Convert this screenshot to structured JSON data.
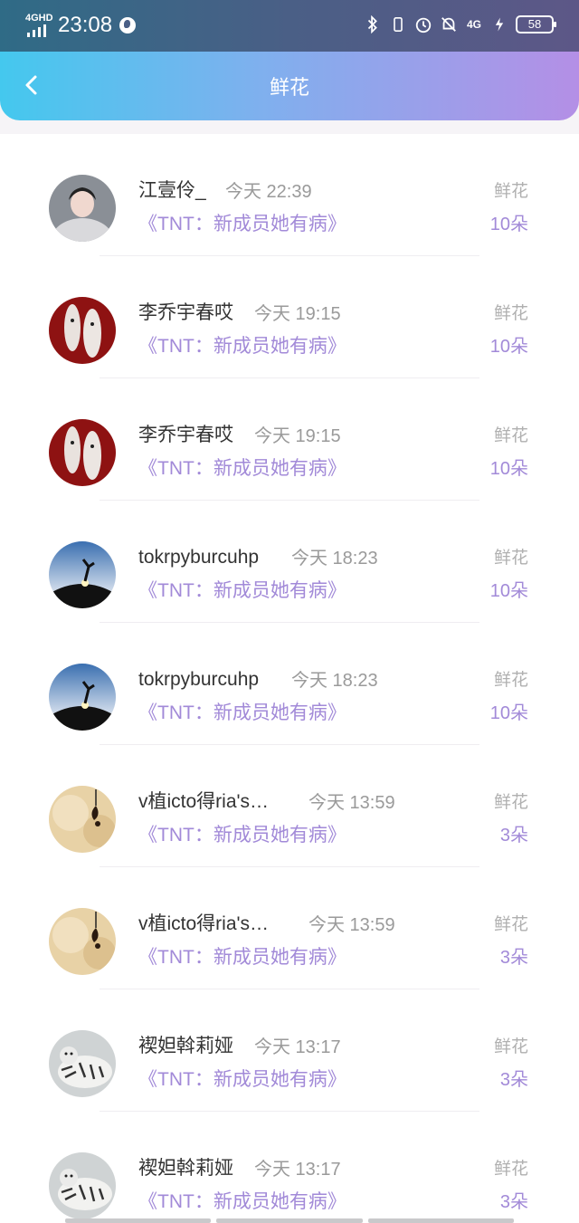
{
  "status_bar": {
    "network_label": "4GHD",
    "time": "23:08",
    "network_type": "4G",
    "battery": "58"
  },
  "nav": {
    "title": "鲜花"
  },
  "rows": [
    {
      "name": "江壹伶_",
      "time": "今天 22:39",
      "book": "《TNT：新成员她有病》",
      "gift": "鲜花",
      "count": "10朵",
      "avatar": "hoodie-person"
    },
    {
      "name": "李乔宇春哎",
      "time": "今天 19:15",
      "book": "《TNT：新成员她有病》",
      "gift": "鲜花",
      "count": "10朵",
      "avatar": "red-figures"
    },
    {
      "name": "李乔宇春哎",
      "time": "今天 19:15",
      "book": "《TNT：新成员她有病》",
      "gift": "鲜花",
      "count": "10朵",
      "avatar": "red-figures"
    },
    {
      "name": "tokrpyburcuhp",
      "time": "今天 18:23",
      "book": "《TNT：新成员她有病》",
      "gift": "鲜花",
      "count": "10朵",
      "avatar": "sunset-dancer"
    },
    {
      "name": "tokrpyburcuhp",
      "time": "今天 18:23",
      "book": "《TNT：新成员她有病》",
      "gift": "鲜花",
      "count": "10朵",
      "avatar": "sunset-dancer"
    },
    {
      "name": "v植icto得ria's…",
      "time": "今天 13:59",
      "book": "《TNT：新成员她有病》",
      "gift": "鲜花",
      "count": "3朵",
      "avatar": "beige-ornament"
    },
    {
      "name": "v植icto得ria's…",
      "time": "今天 13:59",
      "book": "《TNT：新成员她有病》",
      "gift": "鲜花",
      "count": "3朵",
      "avatar": "beige-ornament"
    },
    {
      "name": "褉妲斡莉娅",
      "time": "今天 13:17",
      "book": "《TNT：新成员她有病》",
      "gift": "鲜花",
      "count": "3朵",
      "avatar": "tiger"
    },
    {
      "name": "褉妲斡莉娅",
      "time": "今天 13:17",
      "book": "《TNT：新成员她有病》",
      "gift": "鲜花",
      "count": "3朵",
      "avatar": "tiger"
    }
  ]
}
